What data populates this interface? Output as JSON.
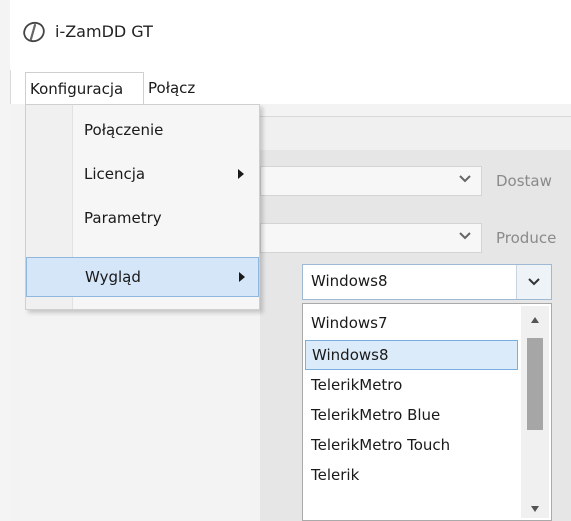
{
  "window": {
    "title": "i-ZamDD GT",
    "icon": "app-logo-icon"
  },
  "menubar": [
    {
      "label": "Konfiguracja",
      "open": true
    },
    {
      "label": "Połącz",
      "open": false
    }
  ],
  "background": {
    "label_1": "Dostaw",
    "label_2": "Produce"
  },
  "menu": {
    "items": [
      {
        "label": "Połączenie",
        "submenu": false,
        "selected": false
      },
      {
        "label": "Licencja",
        "submenu": true,
        "selected": false
      },
      {
        "label": "Parametry",
        "submenu": false,
        "selected": false
      },
      {
        "label": "Wygląd",
        "submenu": true,
        "selected": true
      }
    ]
  },
  "combo": {
    "value": "Windows8",
    "options": [
      {
        "label": "Windows7",
        "selected": false
      },
      {
        "label": "Windows8",
        "selected": true
      },
      {
        "label": "TelerikMetro",
        "selected": false
      },
      {
        "label": "TelerikMetro Blue",
        "selected": false
      },
      {
        "label": "TelerikMetro Touch",
        "selected": false
      },
      {
        "label": "Telerik",
        "selected": false
      }
    ]
  },
  "colors": {
    "selection_bg": "#d4e6f8",
    "selection_border": "#8fb7e0",
    "list_selected_bg": "#dcebfa",
    "app_bg": "#e6e6e6"
  }
}
